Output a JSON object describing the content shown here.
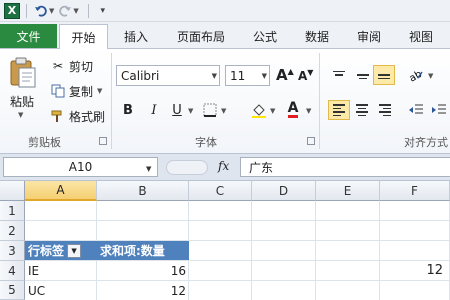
{
  "app": {
    "logo_letter": "X"
  },
  "qat": {
    "undo_icon": "undo-icon",
    "redo_icon": "redo-icon"
  },
  "tabs": [
    {
      "label": "文件"
    },
    {
      "label": "开始"
    },
    {
      "label": "插入"
    },
    {
      "label": "页面布局"
    },
    {
      "label": "公式"
    },
    {
      "label": "数据"
    },
    {
      "label": "审阅"
    },
    {
      "label": "视图"
    }
  ],
  "ribbon": {
    "clipboard": {
      "paste_label": "粘贴",
      "cut_label": "剪切",
      "copy_label": "复制",
      "format_painter_label": "格式刷",
      "group_label": "剪贴板"
    },
    "font": {
      "font_name": "Calibri",
      "font_size": "11",
      "bold": "B",
      "italic": "I",
      "underline": "U",
      "font_color_letter": "A",
      "grow_letter": "A",
      "shrink_letter": "A",
      "group_label": "字体",
      "font_color": "#e01e1e"
    },
    "alignment": {
      "group_label": "对齐方式"
    }
  },
  "formula_bar": {
    "name_box": "A10",
    "fx_label": "fx",
    "content": "广东"
  },
  "sheet": {
    "columns": [
      "A",
      "B",
      "C",
      "D",
      "E",
      "F"
    ],
    "rows": [
      "1",
      "2",
      "3",
      "4",
      "5"
    ],
    "selected_column": "A",
    "pivot_header": {
      "row_label": "行标签",
      "value_label": "求和项:数量"
    },
    "pivot_rows": [
      {
        "label": "IE",
        "value": "16"
      },
      {
        "label": "UC",
        "value": "12"
      }
    ],
    "f4_value": "12",
    "header_color": "#4f81bd",
    "selection_color": "#f5cf72"
  }
}
